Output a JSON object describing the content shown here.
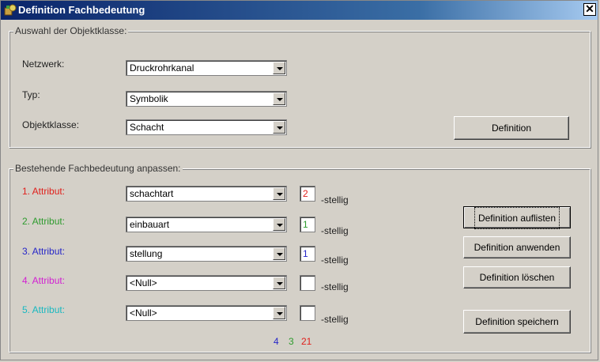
{
  "window": {
    "title": "Definition Fachbedeutung",
    "close_glyph": "✕"
  },
  "group1": {
    "label": "Auswahl der Objektklasse:",
    "rows": [
      {
        "label": "Netzwerk:",
        "value": "Druckrohrkanal"
      },
      {
        "label": "Typ:",
        "value": "Symbolik"
      },
      {
        "label": "Objektklasse:",
        "value": "Schacht"
      }
    ],
    "definition_button": "Definition"
  },
  "group2": {
    "label": "Bestehende Fachbedeutung anpassen:",
    "suffix": "-stellig",
    "attributes": [
      {
        "label": "1. Attribut:",
        "color": "#e0201c",
        "value": "schachtart",
        "digits": "2"
      },
      {
        "label": "2. Attribut:",
        "color": "#2e9b2e",
        "value": "einbauart",
        "digits": "1"
      },
      {
        "label": "3. Attribut:",
        "color": "#2626c8",
        "value": "stellung",
        "digits": "1"
      },
      {
        "label": "4. Attribut:",
        "color": "#d21fd2",
        "value": "<Null>",
        "digits": ""
      },
      {
        "label": "5. Attribut:",
        "color": "#18b8c0",
        "value": "<Null>",
        "digits": ""
      }
    ],
    "buttons": {
      "list": "Definition auflisten",
      "apply": "Definition anwenden",
      "delete": "Definition löschen",
      "save": "Definition speichern"
    },
    "counts": [
      {
        "text": "4",
        "color": "#2626c8"
      },
      {
        "text": "3",
        "color": "#2e9b2e"
      },
      {
        "text": "21",
        "color": "#e0201c"
      }
    ]
  }
}
